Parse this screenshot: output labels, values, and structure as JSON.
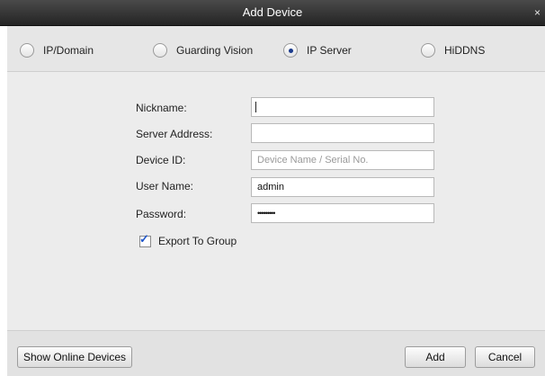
{
  "window": {
    "title": "Add Device",
    "close_glyph": "×"
  },
  "modes": [
    {
      "label": "IP/Domain",
      "selected": false
    },
    {
      "label": "Guarding Vision",
      "selected": false
    },
    {
      "label": "IP Server",
      "selected": true
    },
    {
      "label": "HiDDNS",
      "selected": false
    }
  ],
  "form": {
    "nickname": {
      "label": "Nickname:",
      "value": ""
    },
    "server_address": {
      "label": "Server Address:",
      "value": ""
    },
    "device_id": {
      "label": "Device ID:",
      "value": "",
      "placeholder": "Device Name / Serial No."
    },
    "user_name": {
      "label": "User Name:",
      "value": "admin"
    },
    "password": {
      "label": "Password:",
      "value": "•••••••••"
    },
    "export_to_group": {
      "label": "Export To Group",
      "checked": true,
      "check_glyph": "✓"
    }
  },
  "footer": {
    "show_online_devices": "Show Online Devices",
    "add": "Add",
    "cancel": "Cancel"
  }
}
